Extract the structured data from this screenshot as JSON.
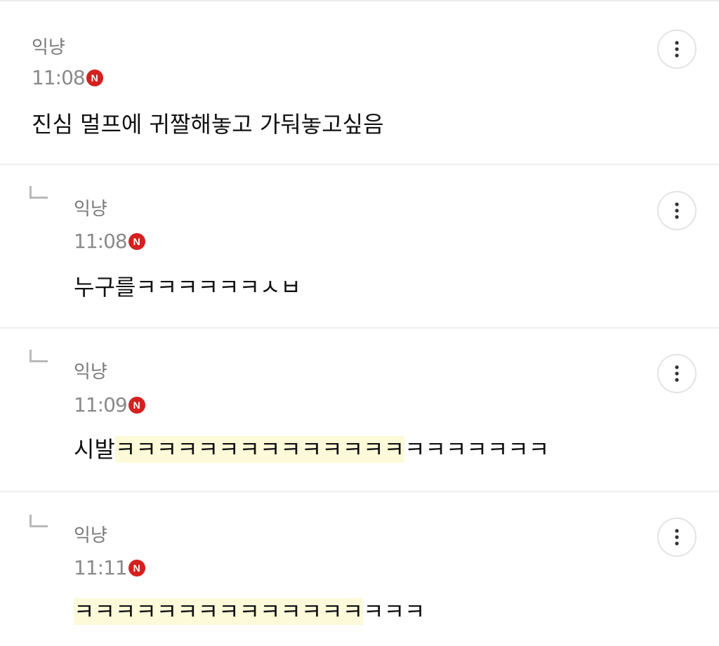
{
  "comments": [
    {
      "author": "익냥",
      "time": "11:08",
      "badge": "N",
      "text": "진심 멀프에 귀짤해놓고 가둬놓고싶음",
      "is_reply": false
    },
    {
      "author": "익냥",
      "time": "11:08",
      "badge": "N",
      "text": "누구를ㅋㅋㅋㅋㅋㅋㅅㅂ",
      "is_reply": true
    },
    {
      "author": "익냥",
      "time": "11:09",
      "badge": "N",
      "text_prefix": "시발",
      "text_highlight": "ㅋㅋㅋㅋㅋㅋㅋㅋㅋㅋㅋㅋㅋㅋ",
      "text_suffix": "ㅋㅋㅋㅋㅋㅋㅋ",
      "is_reply": true
    },
    {
      "author": "익냥",
      "time": "11:11",
      "badge": "N",
      "text_highlight": "ㅋㅋㅋㅋㅋㅋㅋㅋㅋㅋㅋㅋㅋㅋ",
      "text_suffix": "ㅋㅋㅋ",
      "is_reply": true
    }
  ],
  "icons": {
    "more": "more-vertical-icon",
    "reply": "reply-arrow-icon"
  },
  "colors": {
    "new_badge": "#d61f1f",
    "highlight": "#fdfad9",
    "meta_text": "#8a8a8a"
  }
}
